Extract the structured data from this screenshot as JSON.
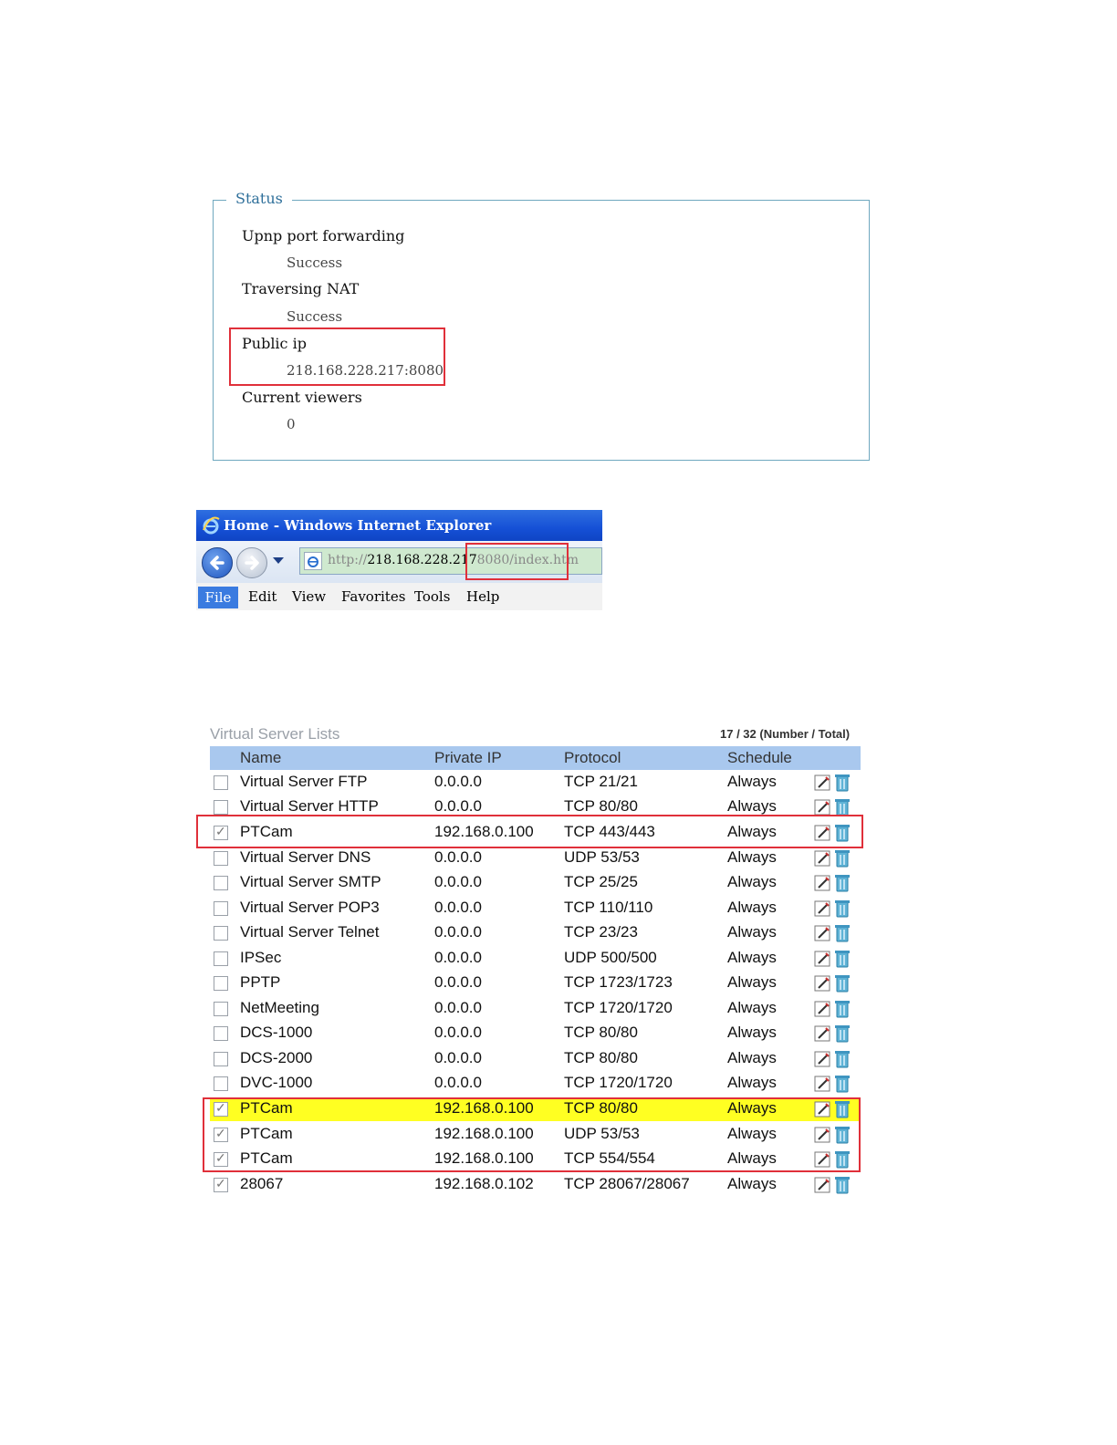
{
  "status": {
    "legend": "Status",
    "items": [
      {
        "label": "Upnp port forwarding",
        "value": "Success"
      },
      {
        "label": "Traversing NAT",
        "value": "Success"
      },
      {
        "label": "Public ip",
        "value": "218.168.228.217:8080"
      },
      {
        "label": "Current viewers",
        "value": "0"
      }
    ]
  },
  "browser": {
    "title": "Home - Windows Internet Explorer",
    "url_protocol": "http://",
    "url_host": "218.168.228.217",
    "url_rest": "8080/index.htm",
    "menu": [
      "File",
      "Edit",
      "View",
      "Favorites",
      "Tools",
      "Help"
    ]
  },
  "virtual_servers": {
    "title": "Virtual Server Lists",
    "count": "17 / 32 (Number / Total)",
    "columns": [
      "Name",
      "Private IP",
      "Protocol",
      "Schedule"
    ],
    "rows": [
      {
        "checked": false,
        "name": "Virtual Server FTP",
        "ip": "0.0.0.0",
        "protocol": "TCP 21/21",
        "schedule": "Always"
      },
      {
        "checked": false,
        "name": "Virtual Server HTTP",
        "ip": "0.0.0.0",
        "protocol": "TCP 80/80",
        "schedule": "Always"
      },
      {
        "checked": true,
        "name": "PTCam",
        "ip": "192.168.0.100",
        "protocol": "TCP 443/443",
        "schedule": "Always"
      },
      {
        "checked": false,
        "name": "Virtual Server DNS",
        "ip": "0.0.0.0",
        "protocol": "UDP 53/53",
        "schedule": "Always"
      },
      {
        "checked": false,
        "name": "Virtual Server SMTP",
        "ip": "0.0.0.0",
        "protocol": "TCP 25/25",
        "schedule": "Always"
      },
      {
        "checked": false,
        "name": "Virtual Server POP3",
        "ip": "0.0.0.0",
        "protocol": "TCP 110/110",
        "schedule": "Always"
      },
      {
        "checked": false,
        "name": "Virtual Server Telnet",
        "ip": "0.0.0.0",
        "protocol": "TCP 23/23",
        "schedule": "Always"
      },
      {
        "checked": false,
        "name": "IPSec",
        "ip": "0.0.0.0",
        "protocol": "UDP 500/500",
        "schedule": "Always"
      },
      {
        "checked": false,
        "name": "PPTP",
        "ip": "0.0.0.0",
        "protocol": "TCP 1723/1723",
        "schedule": "Always"
      },
      {
        "checked": false,
        "name": "NetMeeting",
        "ip": "0.0.0.0",
        "protocol": "TCP 1720/1720",
        "schedule": "Always"
      },
      {
        "checked": false,
        "name": "DCS-1000",
        "ip": "0.0.0.0",
        "protocol": "TCP 80/80",
        "schedule": "Always"
      },
      {
        "checked": false,
        "name": "DCS-2000",
        "ip": "0.0.0.0",
        "protocol": "TCP 80/80",
        "schedule": "Always"
      },
      {
        "checked": false,
        "name": "DVC-1000",
        "ip": "0.0.0.0",
        "protocol": "TCP 1720/1720",
        "schedule": "Always"
      },
      {
        "checked": true,
        "name": "PTCam",
        "ip": "192.168.0.100",
        "protocol": "TCP 80/80",
        "schedule": "Always"
      },
      {
        "checked": true,
        "name": "PTCam",
        "ip": "192.168.0.100",
        "protocol": "UDP 53/53",
        "schedule": "Always"
      },
      {
        "checked": true,
        "name": "PTCam",
        "ip": "192.168.0.100",
        "protocol": "TCP 554/554",
        "schedule": "Always"
      },
      {
        "checked": true,
        "name": "28067",
        "ip": "192.168.0.102",
        "protocol": "TCP 28067/28067",
        "schedule": "Always"
      }
    ]
  }
}
